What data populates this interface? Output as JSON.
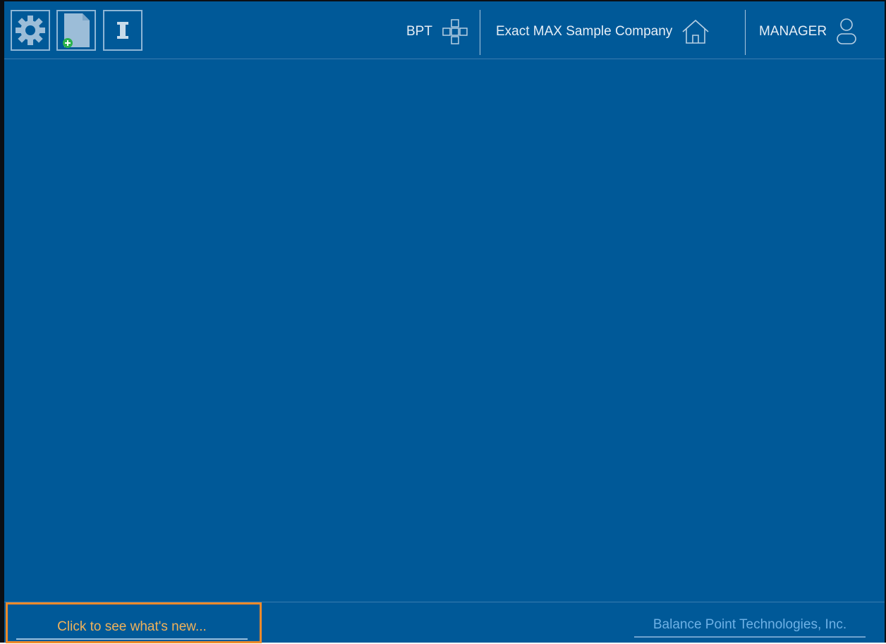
{
  "toolbar": {
    "buttons": [
      {
        "icon": "gear-icon"
      },
      {
        "icon": "new-document-icon"
      },
      {
        "icon": "info-icon"
      }
    ],
    "bpt_label": "BPT",
    "bpt_icon": "modules-icon",
    "company_label": "Exact MAX Sample Company",
    "company_icon": "home-icon",
    "user_label": "MANAGER",
    "user_icon": "user-icon"
  },
  "footer": {
    "whats_new_label": "Click to see what's new...",
    "company_link_label": "Balance Point Technologies, Inc."
  },
  "colors": {
    "background": "#005998",
    "highlight_border": "#ef8a2a",
    "whats_new_text": "#f0b25a",
    "link_text": "#6eb1e6"
  }
}
